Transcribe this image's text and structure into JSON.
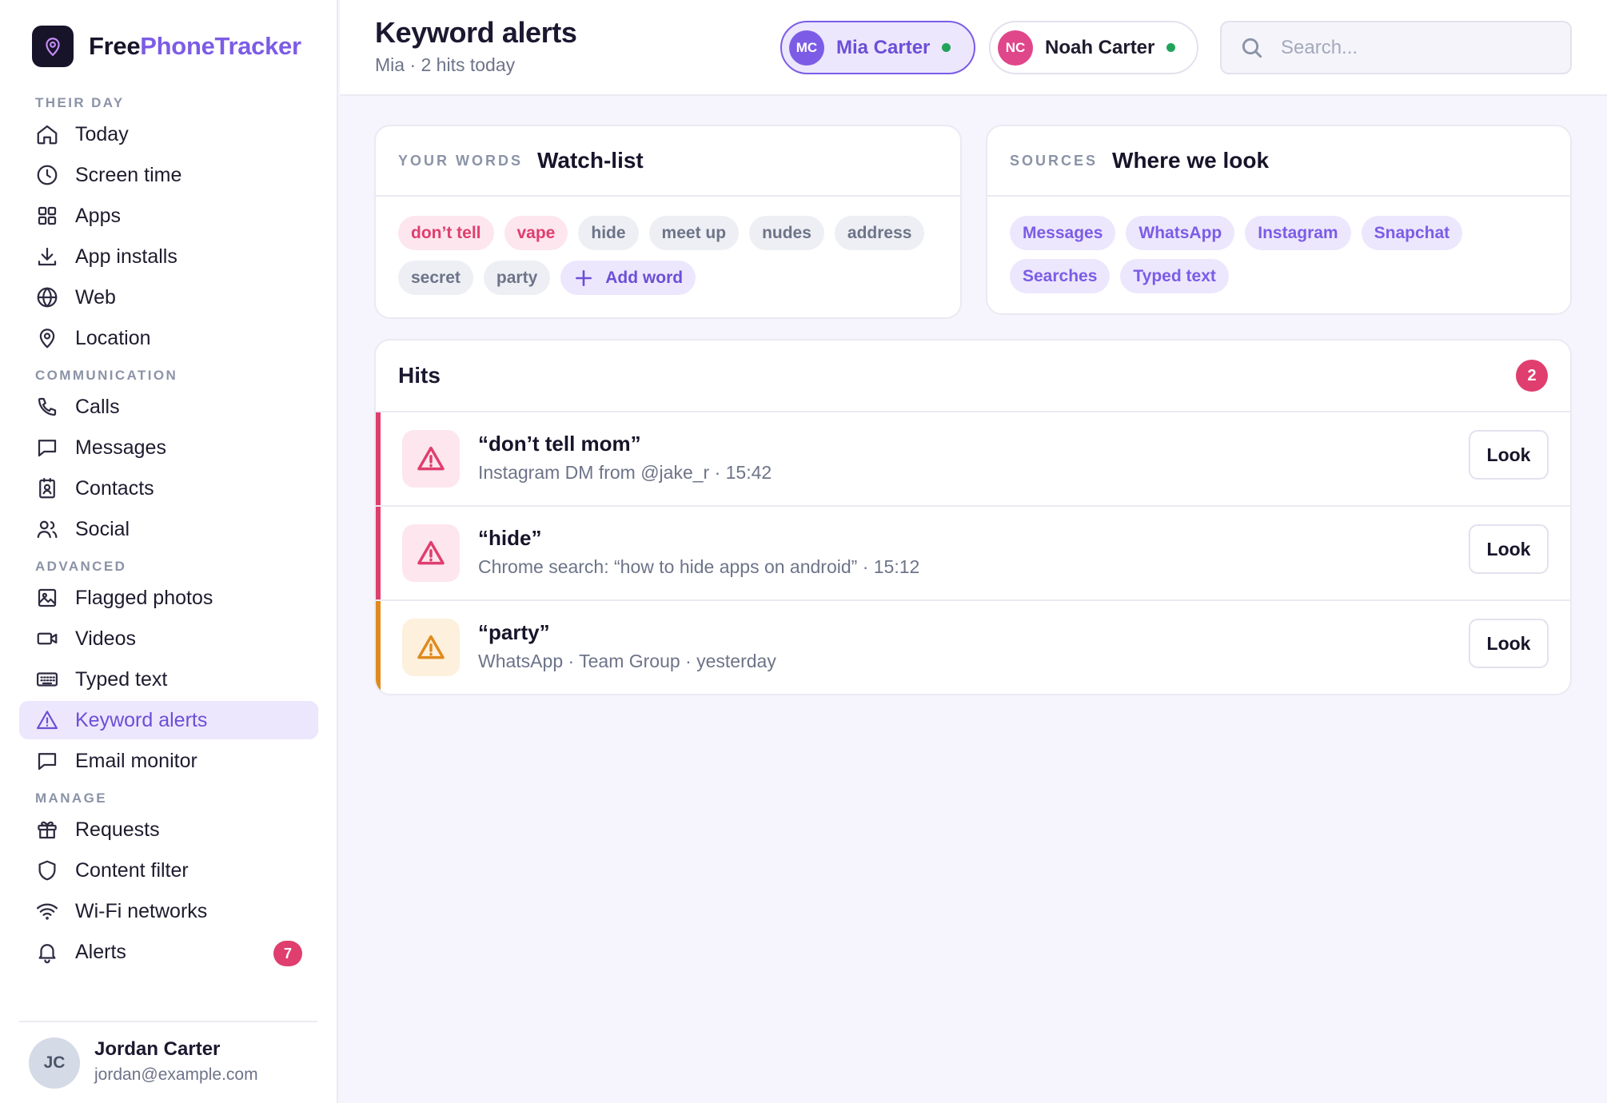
{
  "brand": {
    "part1": "Free",
    "part2": "PhoneTracker"
  },
  "nav": {
    "sections": {
      "their_day": "THEIR DAY",
      "communication": "COMMUNICATION",
      "advanced": "ADVANCED",
      "manage": "MANAGE"
    },
    "items": [
      {
        "label": "Today",
        "icon": "home-icon"
      },
      {
        "label": "Screen time",
        "icon": "clock-icon"
      },
      {
        "label": "Apps",
        "icon": "grid-icon"
      },
      {
        "label": "App installs",
        "icon": "download-icon"
      },
      {
        "label": "Web",
        "icon": "globe-icon"
      },
      {
        "label": "Location",
        "icon": "map-pin-icon"
      },
      {
        "label": "Calls",
        "icon": "phone-icon"
      },
      {
        "label": "Messages",
        "icon": "message-icon"
      },
      {
        "label": "Contacts",
        "icon": "contact-card-icon"
      },
      {
        "label": "Social",
        "icon": "users-icon"
      },
      {
        "label": "Flagged photos",
        "icon": "image-icon"
      },
      {
        "label": "Videos",
        "icon": "video-icon"
      },
      {
        "label": "Typed text",
        "icon": "keyboard-icon"
      },
      {
        "label": "Keyword alerts",
        "icon": "warning-icon",
        "active": true
      },
      {
        "label": "Email monitor",
        "icon": "message-icon"
      },
      {
        "label": "Requests",
        "icon": "gift-icon"
      },
      {
        "label": "Content filter",
        "icon": "shield-icon"
      },
      {
        "label": "Wi-Fi networks",
        "icon": "wifi-icon"
      },
      {
        "label": "Alerts",
        "icon": "bell-icon",
        "badge": "7"
      }
    ]
  },
  "user": {
    "initials": "JC",
    "name": "Jordan Carter",
    "email": "jordan@example.com"
  },
  "header": {
    "title": "Keyword alerts",
    "subtitle": "Mia · 2 hits today",
    "search_placeholder": "Search...",
    "children": [
      {
        "initials": "MC",
        "name": "Mia Carter",
        "selected": true,
        "avatar_color": "#7c5ce6"
      },
      {
        "initials": "NC",
        "name": "Noah Carter",
        "selected": false,
        "avatar_color": "#e0468a"
      }
    ]
  },
  "watchlist": {
    "eyebrow": "YOUR WORDS",
    "title": "Watch-list",
    "words": [
      {
        "text": "don’t tell",
        "hot": true
      },
      {
        "text": "vape",
        "hot": true
      },
      {
        "text": "hide",
        "hot": false
      },
      {
        "text": "meet up",
        "hot": false
      },
      {
        "text": "nudes",
        "hot": false
      },
      {
        "text": "address",
        "hot": false
      },
      {
        "text": "secret",
        "hot": false
      },
      {
        "text": "party",
        "hot": false
      }
    ],
    "add_label": "Add word"
  },
  "sources": {
    "eyebrow": "SOURCES",
    "title": "Where we look",
    "items": [
      "Messages",
      "WhatsApp",
      "Instagram",
      "Snapchat",
      "Searches",
      "Typed text"
    ]
  },
  "hits": {
    "title": "Hits",
    "count": "2",
    "items": [
      {
        "word": "“don’t tell mom”",
        "meta": "Instagram DM from @jake_r · 15:42",
        "severity": "high",
        "color": "#df3e6e",
        "icon_bg": "#fde6ee",
        "button": "Look"
      },
      {
        "word": "“hide”",
        "meta": "Chrome search: “how to hide apps on android” · 15:12",
        "severity": "high",
        "color": "#df3e6e",
        "icon_bg": "#fde6ee",
        "button": "Look"
      },
      {
        "word": "“party”",
        "meta": "WhatsApp · Team Group · yesterday",
        "severity": "medium",
        "color": "#e08a1e",
        "icon_bg": "#fdf0dc",
        "button": "Look"
      }
    ]
  },
  "colors": {
    "accent": "#7c5ce6",
    "danger": "#df3e6e",
    "warning": "#e08a1e",
    "online": "#22a35a"
  }
}
